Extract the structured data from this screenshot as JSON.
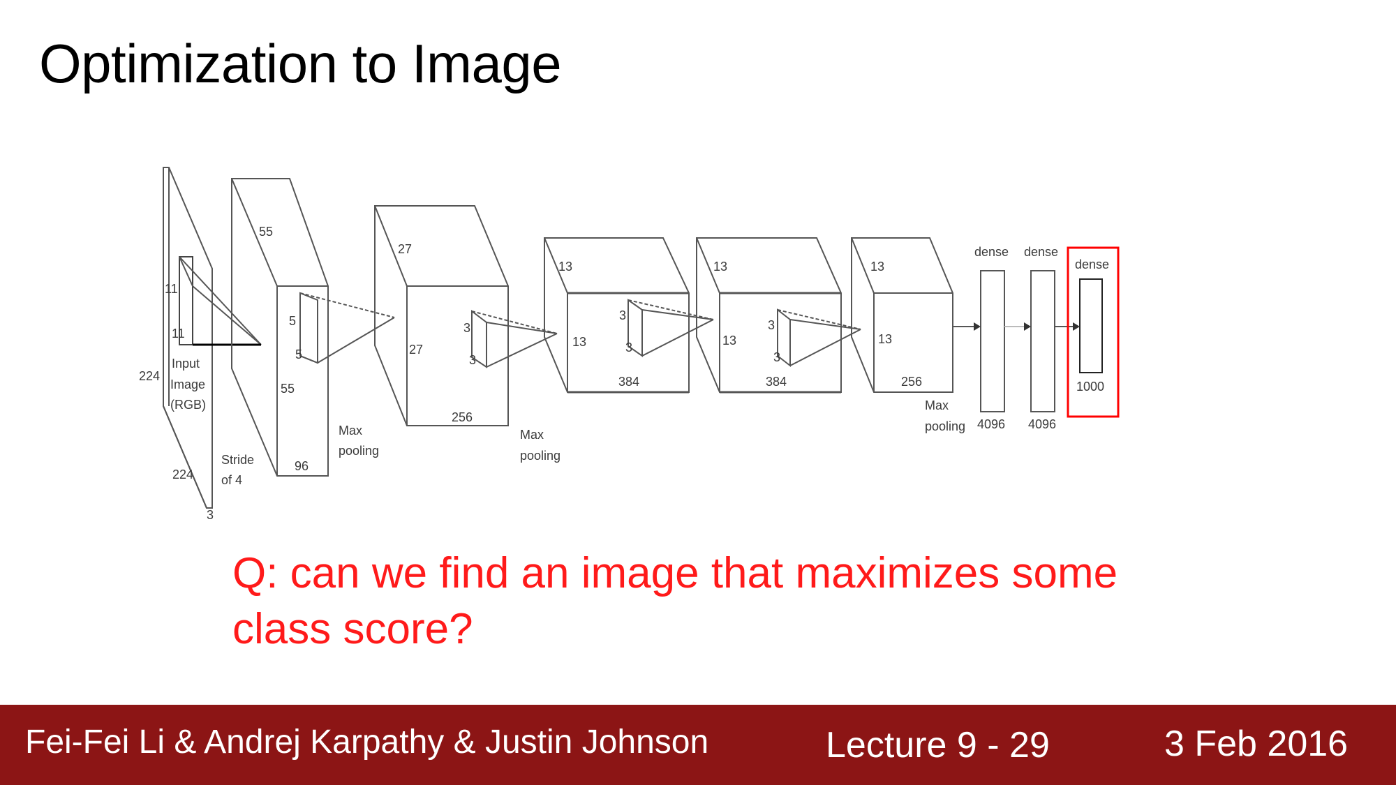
{
  "slide": {
    "title": "Optimization to Image",
    "question": "Q: can we find an image that maximizes some class score?"
  },
  "diagram": {
    "input": {
      "label": "Input\nImage\n(RGB)",
      "height": "224",
      "width": "224",
      "depth": "3",
      "filter_h": "11",
      "filter_w": "11",
      "stride": "Stride\nof 4"
    },
    "conv1": {
      "h": "55",
      "w": "55",
      "depth": "96",
      "filter_h": "5",
      "filter_w": "5"
    },
    "pool1": "Max\npooling",
    "conv2": {
      "h": "27",
      "w": "27",
      "depth": "256",
      "filter_h": "3",
      "filter_w": "3"
    },
    "pool2": "Max\npooling",
    "conv3": {
      "h": "13",
      "w": "13",
      "depth": "384",
      "filter_h": "3",
      "filter_w": "3"
    },
    "conv4": {
      "h": "13",
      "w": "13",
      "depth": "384",
      "filter_h": "3",
      "filter_w": "3"
    },
    "conv5": {
      "h": "13",
      "w": "13",
      "depth": "256"
    },
    "pool3": "Max\npooling",
    "dense1": {
      "label": "dense",
      "size": "4096"
    },
    "dense2": {
      "label": "dense",
      "size": "4096"
    },
    "dense3": {
      "label": "dense",
      "size": "1000"
    },
    "highlight_color": "#ff0000"
  },
  "footer": {
    "authors": "Fei-Fei Li & Andrej Karpathy & Justin Johnson",
    "lecture": "Lecture 9 - 29",
    "date": "3 Feb 2016",
    "bar_color": "#8c1515"
  }
}
